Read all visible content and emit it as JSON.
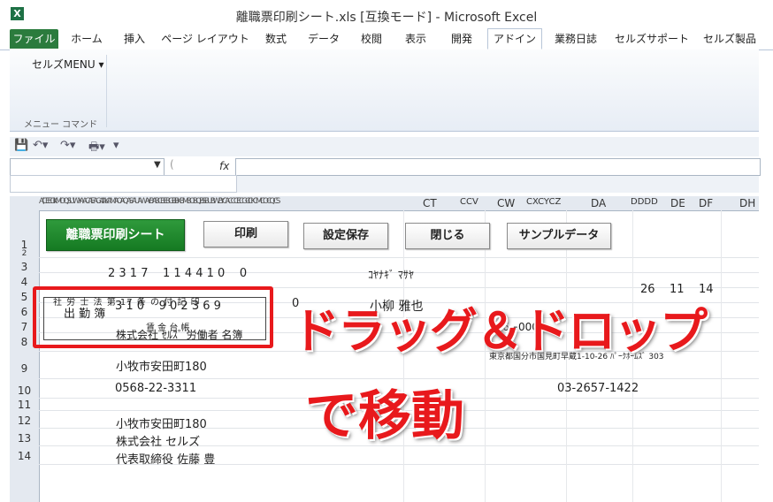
{
  "window": {
    "title": "離職票印刷シート.xls  [互換モード]  -  Microsoft Excel",
    "app_icon": "X"
  },
  "tabs": [
    {
      "label": "ファイル"
    },
    {
      "label": "ホーム"
    },
    {
      "label": "挿入"
    },
    {
      "label": "ページ レイアウト"
    },
    {
      "label": "数式"
    },
    {
      "label": "データ"
    },
    {
      "label": "校閲"
    },
    {
      "label": "表示"
    },
    {
      "label": "開発"
    },
    {
      "label": "アドイン"
    },
    {
      "label": "業務日誌"
    },
    {
      "label": "セルズサポート"
    },
    {
      "label": "セルズ製品"
    }
  ],
  "ribbon": {
    "menu_label": "セルズMENU ▾",
    "group_label": "メニュー コマンド"
  },
  "formula_bar": {
    "fx": "fx",
    "name_value": ""
  },
  "columns": {
    "squished": "A(CEEGIIKMOQSUWYAACAEAGAIAKAMAOAQASAUAWAYBABCBEBGBIBKBMBOBQBSBUBWBYCACCCECGCICKCMCOCQCS",
    "labels": [
      "CT",
      "CCV",
      "CW",
      "CXCYCZ",
      "DA",
      "DDDD",
      "DE",
      "DF",
      "DH"
    ]
  },
  "rows": [
    "1",
    "2",
    "3",
    "4",
    "5",
    "6",
    "7",
    "8",
    "9",
    "10",
    "11",
    "12",
    "13",
    "14"
  ],
  "buttons": {
    "print_sheet": "離職票印刷シート",
    "print": "印刷",
    "save_settings": "設定保存",
    "close": "閉じる",
    "sample_data": "サンプルデータ"
  },
  "cells": {
    "r3_digits": "2 3 1 7    1 1 4 4 1 0    0",
    "r3_name_kana": "ｺﾔﾅｷﾞ ﾏｻﾔ",
    "r5_digits": "3 1 0    9 0 2 3 6 9",
    "r5_zero": "0",
    "r5_name": "小柳 雅也",
    "r4_d1": "26",
    "r4_d2": "11",
    "r4_d3": "14",
    "stamp_top": "社 労 士 法 第 17 条 の 付 記 印",
    "stamp_mid": "出 勤 簿",
    "stamp_chin": "賃 金 台 帳",
    "stamp_bottom": "株式会社 ｾﾙｽﾞ 労働者 名簿",
    "r7_zip": "476−0005",
    "r8_addr": "東京都国分市国見町早蔵1-10-26 ﾊﾟｰｸﾎｰﾑｽﾞ 303",
    "r9": "小牧市安田町180",
    "r10_tel1": "0568-22-3311",
    "r10_tel2": "03-2657-1422",
    "r12": "小牧市安田町180",
    "r13": "株式会社 セルズ",
    "r14": "代表取締役 佐藤 豊"
  },
  "overlay": {
    "line1": "ドラッグ＆ドロップ",
    "line2": "で移動"
  }
}
